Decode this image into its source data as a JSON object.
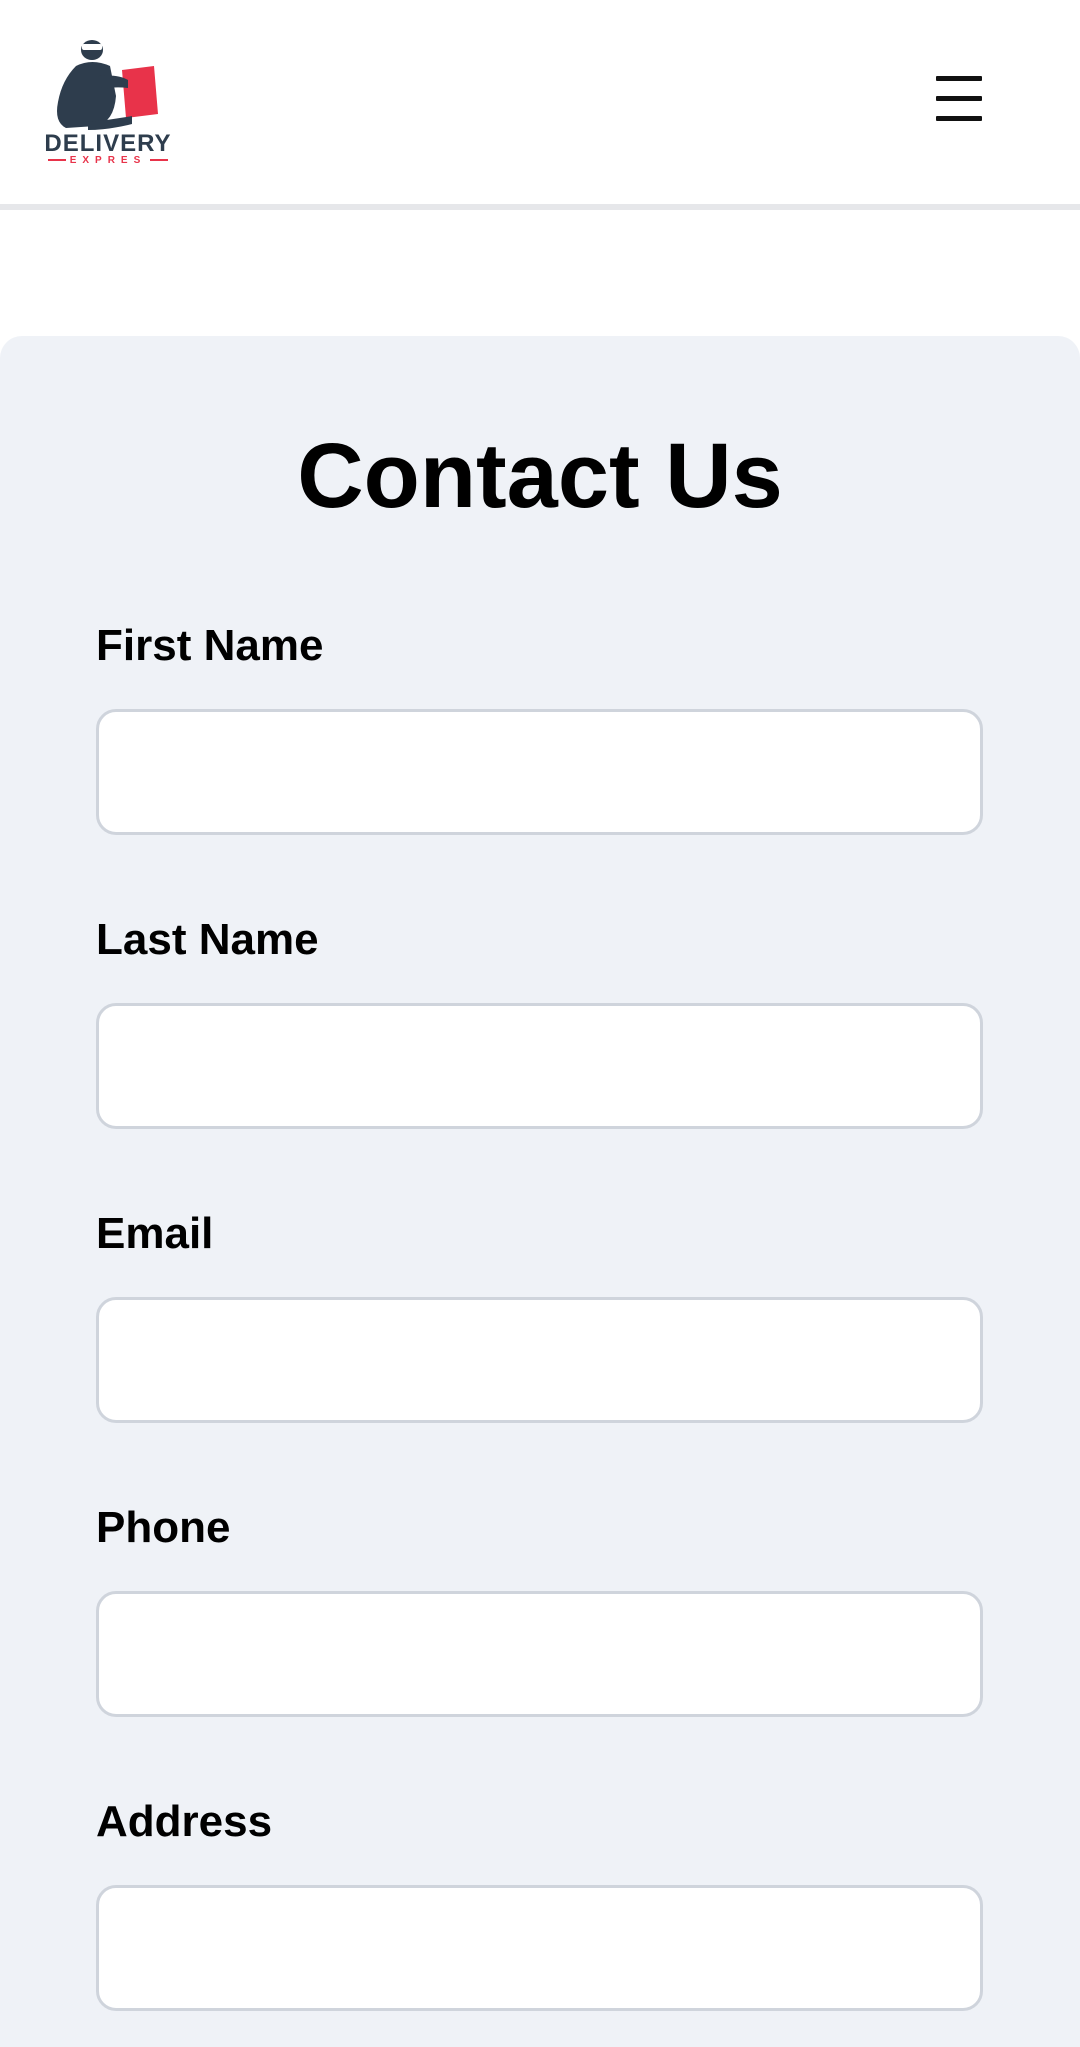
{
  "header": {
    "logo": {
      "wordmark": "DELIVERY",
      "sub": "EXPRES",
      "colors": {
        "dark": "#2e3d4d",
        "accent": "#e8334a"
      }
    },
    "menu_icon": "hamburger-menu-icon"
  },
  "contact": {
    "title": "Contact Us",
    "fields": [
      {
        "label": "First Name",
        "value": "",
        "placeholder": ""
      },
      {
        "label": "Last Name",
        "value": "",
        "placeholder": ""
      },
      {
        "label": "Email",
        "value": "",
        "placeholder": ""
      },
      {
        "label": "Phone",
        "value": "",
        "placeholder": ""
      },
      {
        "label": "Address",
        "value": "",
        "placeholder": ""
      }
    ]
  },
  "colors": {
    "page_bg": "#ffffff",
    "card_bg": "#eff2f7",
    "input_border": "#cfd4dc"
  }
}
